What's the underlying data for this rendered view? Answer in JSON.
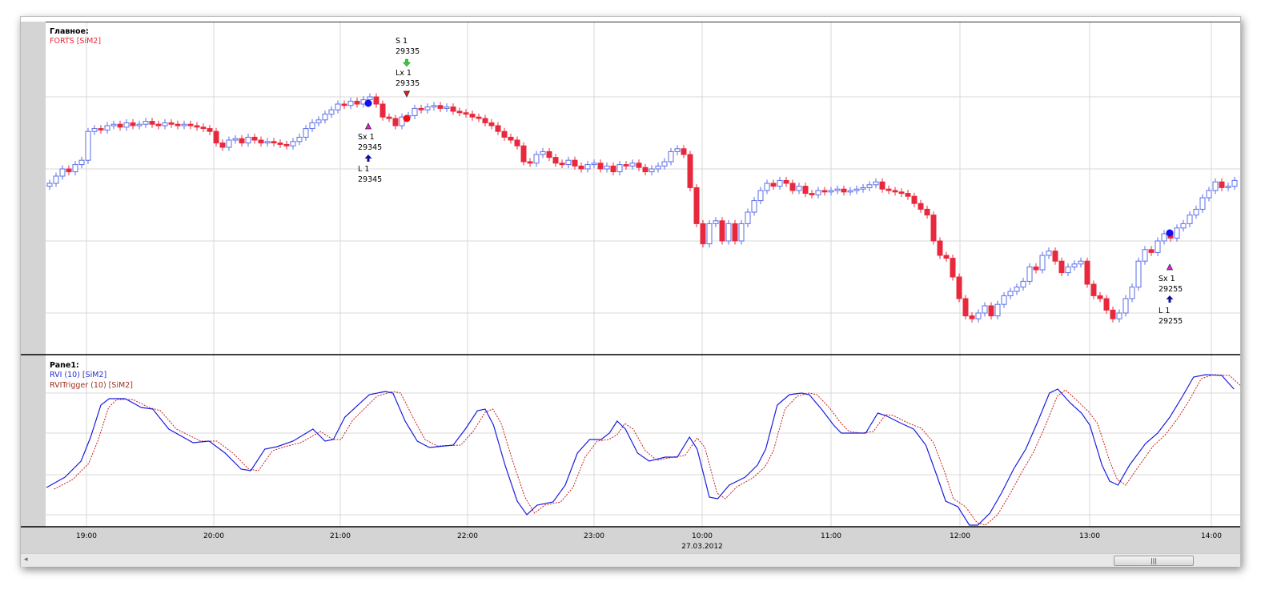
{
  "main_pane": {
    "title": "Главное:",
    "series_label": "FORTS [SiM2]"
  },
  "indicator_pane": {
    "title": "Pane1:",
    "rvi_label": "RVI (10) [SiM2]",
    "trigger_label": "RVITrigger (10) [SiM2]"
  },
  "time_axis": {
    "ticks": [
      "19:00",
      "20:00",
      "21:00",
      "22:00",
      "23:00",
      "10:00",
      "11:00",
      "12:00",
      "13:00",
      "14:00"
    ],
    "date_label": "27.03.2012"
  },
  "scrollbar": {
    "thumb_grip": "|||",
    "left_arrow": "◂"
  },
  "colors": {
    "bull": "#5b6ee8",
    "bear": "#e8283c",
    "rvi": "#1c1ce0",
    "trigger": "#cc2020",
    "grid": "#d8d8d8"
  },
  "trades": [
    {
      "label": "Sx 1",
      "price": "29345",
      "kind": "short-exit"
    },
    {
      "label": "L 1",
      "price": "29345",
      "kind": "long-entry"
    },
    {
      "label": "S 1",
      "price": "29335",
      "kind": "short-entry"
    },
    {
      "label": "Lx 1",
      "price": "29335",
      "kind": "long-exit"
    },
    {
      "label": "Sx 1",
      "price": "29255",
      "kind": "short-exit"
    },
    {
      "label": "L 1",
      "price": "29255",
      "kind": "long-entry"
    }
  ],
  "chart_data": [
    {
      "type": "candlestick",
      "title": "Главное: FORTS [SiM2]",
      "bar_interval": "3 min",
      "price_gridlines": [
        29350,
        29300,
        29250,
        29200
      ],
      "ylim": [
        29171,
        29401
      ],
      "close": [
        29290,
        29295,
        29300,
        29298,
        29303,
        29306,
        29326,
        29328,
        29327,
        29330,
        29331,
        29329,
        29332,
        29330,
        29331,
        29333,
        29331,
        29330,
        29332,
        29331,
        29330,
        29331,
        29330,
        29329,
        29328,
        29326,
        29318,
        29315,
        29320,
        29321,
        29318,
        29322,
        29320,
        29318,
        29319,
        29318,
        29317,
        29316,
        29319,
        29322,
        29328,
        29332,
        29334,
        29338,
        29341,
        29345,
        29344,
        29347,
        29345,
        29348,
        29350,
        29345,
        29336,
        29335,
        29330,
        29336,
        29337,
        29342,
        29341,
        29343,
        29344,
        29342,
        29343,
        29340,
        29339,
        29338,
        29336,
        29335,
        29332,
        29330,
        29326,
        29322,
        29320,
        29316,
        29305,
        29304,
        29310,
        29312,
        29308,
        29304,
        29303,
        29306,
        29302,
        29300,
        29303,
        29304,
        29300,
        29302,
        29298,
        29303,
        29302,
        29304,
        29301,
        29298,
        29300,
        29302,
        29305,
        29312,
        29314,
        29310,
        29287,
        29262,
        29248,
        29262,
        29264,
        29250,
        29262,
        29250,
        29262,
        29270,
        29278,
        29285,
        29290,
        29288,
        29292,
        29290,
        29285,
        29288,
        29283,
        29282,
        29285,
        29284,
        29285,
        29286,
        29284,
        29285,
        29286,
        29287,
        29289,
        29291,
        29286,
        29285,
        29284,
        29283,
        29281,
        29276,
        29272,
        29268,
        29250,
        29240,
        29238,
        29225,
        29210,
        29198,
        29196,
        29200,
        29205,
        29198,
        29206,
        29212,
        29215,
        29218,
        29222,
        29232,
        29230,
        29240,
        29243,
        29236,
        29228,
        29232,
        29234,
        29236,
        29220,
        29212,
        29210,
        29202,
        29196,
        29200,
        29210,
        29218,
        29236,
        29244,
        29242,
        29250,
        29255,
        29252,
        29259,
        29262,
        29268,
        29272,
        29280,
        29285,
        29291,
        29287,
        29288,
        29292
      ]
    },
    {
      "type": "line",
      "title": "Pane1",
      "series": [
        {
          "name": "RVI (10) [SiM2]",
          "points": [
            [
              -0.5,
              -0.58
            ],
            [
              2.4,
              -0.45
            ],
            [
              4.9,
              -0.25
            ],
            [
              6.4,
              0.05
            ],
            [
              8,
              0.45
            ],
            [
              9.3,
              0.53
            ],
            [
              11.8,
              0.53
            ],
            [
              14.3,
              0.42
            ],
            [
              16.1,
              0.4
            ],
            [
              18.6,
              0.15
            ],
            [
              22.4,
              -0.02
            ],
            [
              24.9,
              0
            ],
            [
              27.4,
              -0.15
            ],
            [
              29.9,
              -0.35
            ],
            [
              31.4,
              -0.37
            ],
            [
              33.6,
              -0.1
            ],
            [
              35.5,
              -0.07
            ],
            [
              38,
              0
            ],
            [
              41.1,
              0.15
            ],
            [
              43,
              0
            ],
            [
              44.3,
              0.02
            ],
            [
              46.1,
              0.3
            ],
            [
              49.9,
              0.58
            ],
            [
              52.4,
              0.62
            ],
            [
              53.6,
              0.6
            ],
            [
              55.5,
              0.25
            ],
            [
              57.4,
              0
            ],
            [
              59.3,
              -0.08
            ],
            [
              63,
              -0.05
            ],
            [
              64.9,
              0.15
            ],
            [
              66.8,
              0.38
            ],
            [
              68,
              0.4
            ],
            [
              69.3,
              0.2
            ],
            [
              71.1,
              -0.3
            ],
            [
              73,
              -0.75
            ],
            [
              74.5,
              -0.92
            ],
            [
              76.1,
              -0.8
            ],
            [
              78.6,
              -0.76
            ],
            [
              80.5,
              -0.55
            ],
            [
              82.4,
              -0.15
            ],
            [
              84.3,
              0.02
            ],
            [
              86.1,
              0.02
            ],
            [
              87.4,
              0.1
            ],
            [
              88.6,
              0.25
            ],
            [
              89.9,
              0.15
            ],
            [
              91.8,
              -0.15
            ],
            [
              93.6,
              -0.25
            ],
            [
              96.1,
              -0.2
            ],
            [
              98,
              -0.2
            ],
            [
              99.9,
              0.05
            ],
            [
              101.1,
              -0.1
            ],
            [
              103,
              -0.7
            ],
            [
              104.3,
              -0.72
            ],
            [
              106.1,
              -0.55
            ],
            [
              108.6,
              -0.45
            ],
            [
              110.5,
              -0.3
            ],
            [
              111.8,
              -0.1
            ],
            [
              113.6,
              0.45
            ],
            [
              115.5,
              0.58
            ],
            [
              117.4,
              0.6
            ],
            [
              118.6,
              0.58
            ],
            [
              120.5,
              0.4
            ],
            [
              122.4,
              0.2
            ],
            [
              123.6,
              0.1
            ],
            [
              125.5,
              0.1
            ],
            [
              127.4,
              0.1
            ],
            [
              129.3,
              0.35
            ],
            [
              130.5,
              0.32
            ],
            [
              133,
              0.22
            ],
            [
              134.9,
              0.15
            ],
            [
              136.8,
              -0.05
            ],
            [
              138.6,
              -0.45
            ],
            [
              139.9,
              -0.75
            ],
            [
              141.8,
              -0.82
            ],
            [
              143.6,
              -1.05
            ],
            [
              144.9,
              -1.05
            ],
            [
              146.8,
              -0.9
            ],
            [
              148.6,
              -0.65
            ],
            [
              150.5,
              -0.35
            ],
            [
              152.4,
              -0.1
            ],
            [
              154.3,
              0.25
            ],
            [
              156.1,
              0.6
            ],
            [
              157.4,
              0.65
            ],
            [
              159.3,
              0.48
            ],
            [
              161.1,
              0.35
            ],
            [
              162.4,
              0.2
            ],
            [
              164.3,
              -0.3
            ],
            [
              165.5,
              -0.5
            ],
            [
              166.8,
              -0.55
            ],
            [
              168.6,
              -0.3
            ],
            [
              171.1,
              -0.03
            ],
            [
              173,
              0.1
            ],
            [
              174.9,
              0.3
            ],
            [
              176.8,
              0.55
            ],
            [
              178.6,
              0.8
            ],
            [
              180.5,
              0.83
            ],
            [
              183,
              0.82
            ],
            [
              184.9,
              0.65
            ]
          ]
        },
        {
          "name": "RVITrigger (10) [SiM2]",
          "points": [
            [
              0.7,
              -0.6
            ],
            [
              3.6,
              -0.48
            ],
            [
              6.1,
              -0.28
            ],
            [
              7.6,
              0.02
            ],
            [
              9.2,
              0.42
            ],
            [
              10.5,
              0.52
            ],
            [
              13,
              0.52
            ],
            [
              15.5,
              0.42
            ],
            [
              17.3,
              0.38
            ],
            [
              19.8,
              0.15
            ],
            [
              23.6,
              0
            ],
            [
              26.1,
              0
            ],
            [
              28.6,
              -0.15
            ],
            [
              31.1,
              -0.35
            ],
            [
              32.6,
              -0.37
            ],
            [
              34.8,
              -0.12
            ],
            [
              36.7,
              -0.07
            ],
            [
              39.2,
              -0.02
            ],
            [
              42.3,
              0.12
            ],
            [
              44.2,
              0.02
            ],
            [
              45.5,
              0.02
            ],
            [
              47.3,
              0.26
            ],
            [
              51.1,
              0.56
            ],
            [
              53.6,
              0.62
            ],
            [
              54.8,
              0.6
            ],
            [
              56.7,
              0.3
            ],
            [
              58.6,
              0.02
            ],
            [
              60.5,
              -0.06
            ],
            [
              64.2,
              -0.05
            ],
            [
              66.1,
              0.12
            ],
            [
              68,
              0.36
            ],
            [
              69.2,
              0.4
            ],
            [
              70.5,
              0.22
            ],
            [
              72.3,
              -0.25
            ],
            [
              74.2,
              -0.7
            ],
            [
              75.7,
              -0.9
            ],
            [
              77.3,
              -0.8
            ],
            [
              79.8,
              -0.76
            ],
            [
              81.7,
              -0.58
            ],
            [
              83.6,
              -0.2
            ],
            [
              85.5,
              0
            ],
            [
              87.3,
              0.02
            ],
            [
              88.6,
              0.08
            ],
            [
              89.8,
              0.22
            ],
            [
              91.1,
              0.15
            ],
            [
              93,
              -0.12
            ],
            [
              94.8,
              -0.24
            ],
            [
              97.3,
              -0.2
            ],
            [
              99.2,
              -0.18
            ],
            [
              101.1,
              0.04
            ],
            [
              102.3,
              -0.08
            ],
            [
              104.2,
              -0.65
            ],
            [
              105.5,
              -0.72
            ],
            [
              107.3,
              -0.57
            ],
            [
              109.8,
              -0.46
            ],
            [
              111.7,
              -0.32
            ],
            [
              113,
              -0.12
            ],
            [
              114.8,
              0.4
            ],
            [
              116.7,
              0.56
            ],
            [
              118.6,
              0.6
            ],
            [
              119.8,
              0.58
            ],
            [
              121.7,
              0.42
            ],
            [
              123.6,
              0.22
            ],
            [
              124.8,
              0.12
            ],
            [
              126.7,
              0.1
            ],
            [
              128.6,
              0.12
            ],
            [
              130.5,
              0.33
            ],
            [
              131.7,
              0.32
            ],
            [
              134.2,
              0.22
            ],
            [
              136.1,
              0.16
            ],
            [
              138,
              -0.02
            ],
            [
              139.8,
              -0.4
            ],
            [
              141.1,
              -0.72
            ],
            [
              143,
              -0.82
            ],
            [
              144.8,
              -1.02
            ],
            [
              146.1,
              -1.05
            ],
            [
              148,
              -0.92
            ],
            [
              149.8,
              -0.68
            ],
            [
              151.7,
              -0.4
            ],
            [
              153.6,
              -0.14
            ],
            [
              155.5,
              0.2
            ],
            [
              157.3,
              0.56
            ],
            [
              158.6,
              0.64
            ],
            [
              160.5,
              0.5
            ],
            [
              162.3,
              0.36
            ],
            [
              163.6,
              0.22
            ],
            [
              165.5,
              -0.25
            ],
            [
              166.7,
              -0.48
            ],
            [
              168,
              -0.55
            ],
            [
              169.8,
              -0.34
            ],
            [
              172.3,
              -0.06
            ],
            [
              174.2,
              0.08
            ],
            [
              176.1,
              0.28
            ],
            [
              178,
              0.52
            ],
            [
              179.8,
              0.78
            ],
            [
              181.7,
              0.83
            ],
            [
              184.2,
              0.82
            ],
            [
              186.1,
              0.68
            ]
          ]
        }
      ],
      "value_gridlines": [
        0.6,
        0.1,
        -0.42,
        -0.92
      ],
      "ylim": [
        -1.07,
        1.07
      ]
    }
  ]
}
